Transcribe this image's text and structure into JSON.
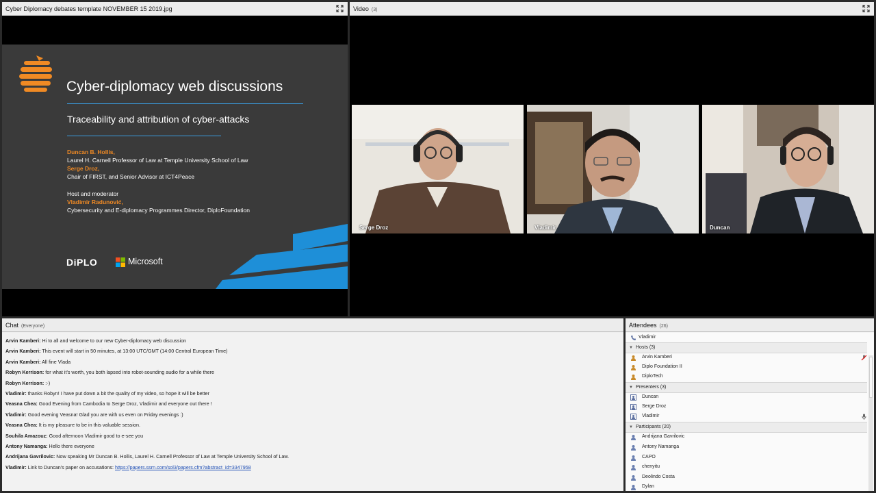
{
  "share_pod": {
    "title": "Cyber Diplomacy debates template NOVEMBER 15 2019.jpg",
    "slide": {
      "title": "Cyber-diplomacy web discussions",
      "subtitle": "Traceability and attribution of cyber-attacks",
      "speaker1_name": "Duncan B. Hollis,",
      "speaker1_role": "Laurel H. Carnell Professor of Law at Temple University School of Law",
      "speaker2_name": "Serge Droz,",
      "speaker2_role": "Chair of FIRST, and Senior Advisor at ICT4Peace",
      "host_label": "Host and moderator",
      "host_name": "Vladimir Radunović,",
      "host_role": "Cybersecurity and E-diplomacy Programmes Director, DiploFoundation",
      "logo_diplo": "DiPLO",
      "logo_microsoft": "Microsoft"
    }
  },
  "video_pod": {
    "title": "Video",
    "count": "(3)",
    "tiles": [
      {
        "name": "Serge Droz"
      },
      {
        "name": "Vladimir"
      },
      {
        "name": "Duncan"
      }
    ]
  },
  "chat_pod": {
    "title": "Chat",
    "scope": "(Everyone)",
    "messages": [
      {
        "sender": "Arvin Kamberi:",
        "text": " Hi to all and welcome to our new Cyber-diplomacy web discussion"
      },
      {
        "sender": "Arvin Kamberi:",
        "text": " This event will start in 50 minutes, at 13:00 UTC/GMT (14:00 Central European Time)"
      },
      {
        "sender": "Arvin Kamberi:",
        "text": " All fine Vlada"
      },
      {
        "sender": "Robyn Kerrison:",
        "text": " for what it's worth, you both lapsed into robot-sounding audio for a while there"
      },
      {
        "sender": "Robyn Kerrison:",
        "text": " :-)"
      },
      {
        "sender": "Vladimir:",
        "text": " thanks Robyn! I have put down a bit the quality of my video, so hope it will be better"
      },
      {
        "sender": "Veasna Chea:",
        "text": " Good Evening from Cambodia to Serge Droz, Vladimir and everyone out there !"
      },
      {
        "sender": "Vladimir:",
        "text": " Good evening Veasna! Glad you are with us even  on Friday evenings :)"
      },
      {
        "sender": "Veasna Chea:",
        "text": " It is my pleasure to be in this valuable session."
      },
      {
        "sender": "Souhila Amazouz:",
        "text": " Good afternoon Vladimir  good  to e-see you"
      },
      {
        "sender": "Antony Namanga:",
        "text": " Hello there everyone"
      },
      {
        "sender": "Andrijana Gavrilovic:",
        "text": " Now speaking Mr Duncan B. Hollis, Laurel H. Carnell Professor of Law at Temple University School of Law."
      },
      {
        "sender": "Vladimir:",
        "text": " Link to Duncan's paper on accusations: ",
        "link": "https://papers.ssrn.com/sol3/papers.cfm?abstract_id=3347958"
      }
    ]
  },
  "attendees_pod": {
    "title": "Attendees",
    "count": "(26)",
    "me": "Vladimir",
    "hosts_label": "Hosts (3)",
    "hosts": [
      "Arvin Kamberi",
      "Diplo Foundation II",
      "DiploTech"
    ],
    "presenters_label": "Presenters (3)",
    "presenters": [
      "Duncan",
      "Serge Droz",
      "Vladimir"
    ],
    "participants_label": "Participants (20)",
    "participants": [
      "Andrijana Gavrilovic",
      "Antony Namanga",
      "CAPO",
      "chenyitu",
      "Deolindo Costa",
      "Dylan"
    ]
  },
  "colors": {
    "accent_orange": "#f08a24",
    "accent_blue": "#1e8fd8",
    "link": "#1f4fb5"
  }
}
